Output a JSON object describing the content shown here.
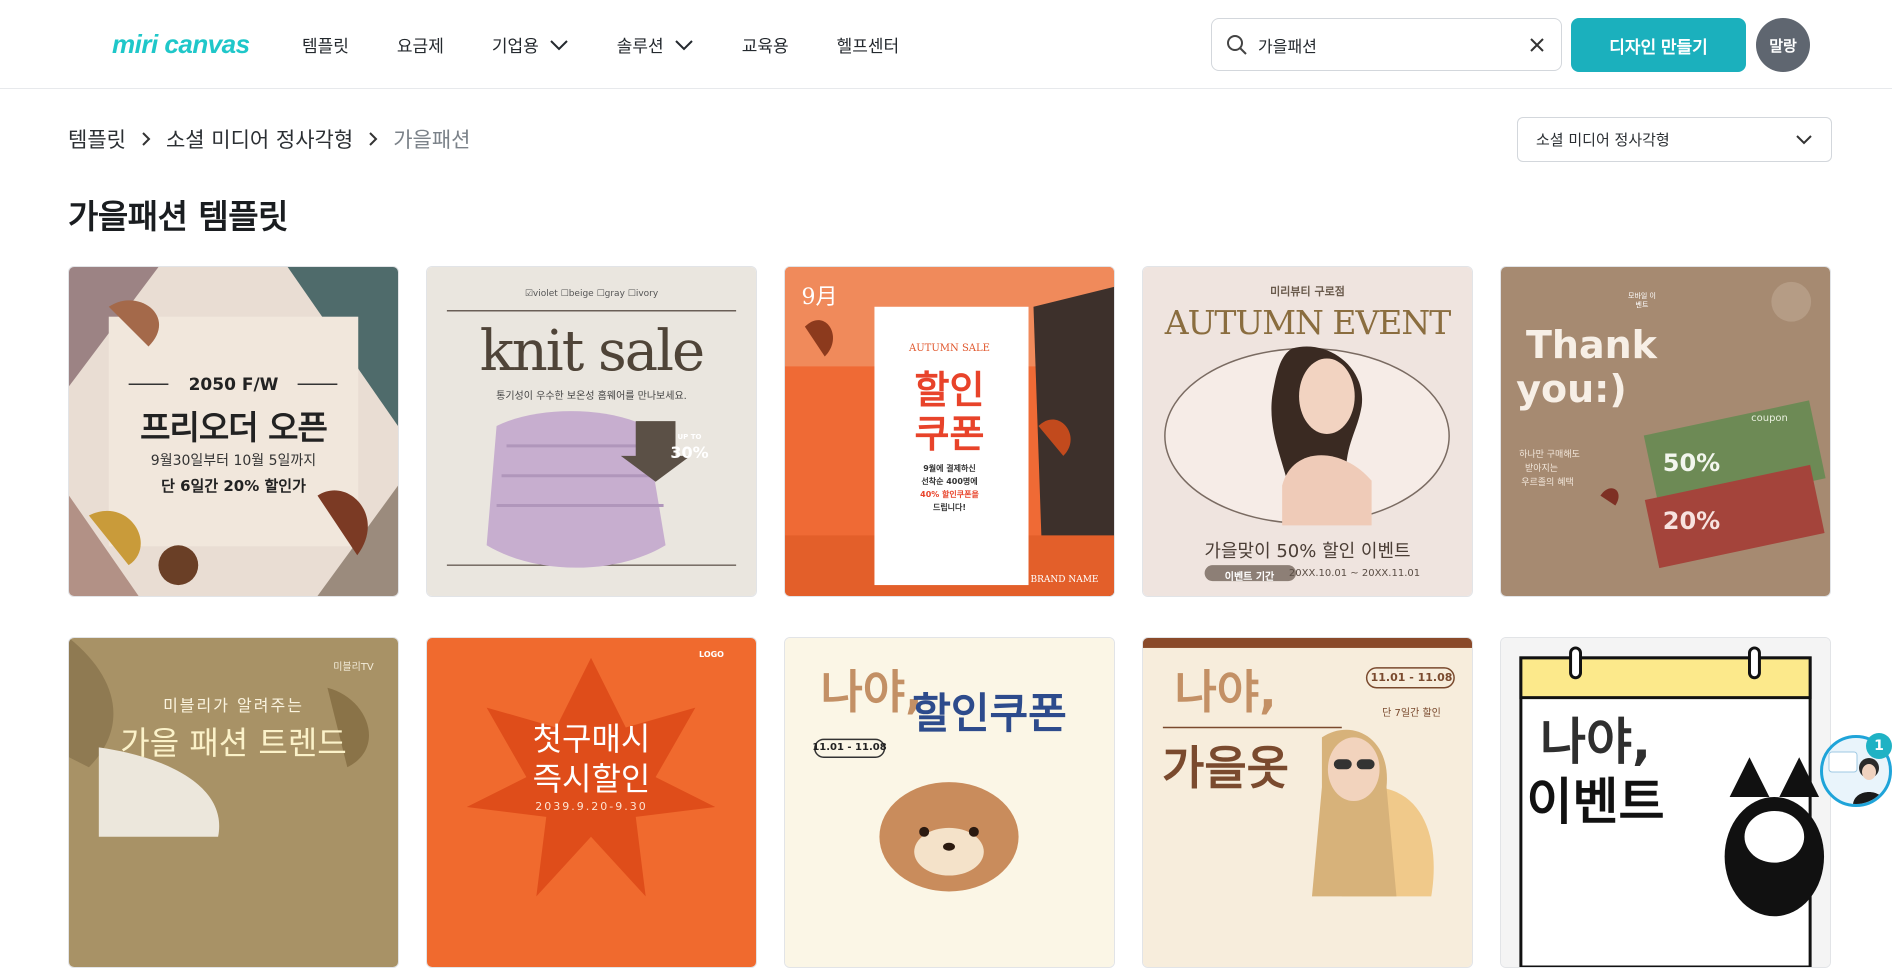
{
  "header": {
    "logo_text": "miri canvas",
    "nav": [
      {
        "label": "템플릿",
        "dropdown": false
      },
      {
        "label": "요금제",
        "dropdown": false
      },
      {
        "label": "기업용",
        "dropdown": true
      },
      {
        "label": "솔루션",
        "dropdown": true
      },
      {
        "label": "교육용",
        "dropdown": false
      },
      {
        "label": "헬프센터",
        "dropdown": false
      }
    ],
    "search_value": "가을패션",
    "make_button": "디자인 만들기",
    "avatar_label": "말랑"
  },
  "breadcrumb": [
    "템플릿",
    "소셜 미디어 정사각형",
    "가을패션"
  ],
  "format_select": "소셜 미디어 정사각형",
  "page_title": "가을패션 템플릿",
  "cards": {
    "c1": {
      "l1": "2050 F/W",
      "l2": "프리오더 오픈",
      "l3": "9월30일부터 10월 5일까지",
      "l4": "단 6일간 20% 할인가"
    },
    "c2": {
      "opts": "☑violet ☐beige ☐gray ☐ivory",
      "l1": "knit sale",
      "l2": "통기성이 우수한 보온성 홈웨어를 만나보세요.",
      "badge_up": "UP TO",
      "badge_pct": "30%"
    },
    "c3": {
      "month": "9月",
      "l1": "AUTUMN SALE",
      "l2": "할인",
      "l3": "쿠폰",
      "l4": "9월에 결제하신",
      "l5": "선착순 400명에",
      "l6": "40% 할인쿠폰을",
      "l7": "드립니다!",
      "brand": "BRAND NAME"
    },
    "c4": {
      "l0": "미리뷰티 구로점",
      "l1": "AUTUMN EVENT",
      "l2": "가을맞이 50% 할인 이벤트",
      "pill": "이벤트 기간",
      "dates": "20XX.10.01 ~ 20XX.11.01"
    },
    "c5": {
      "l1": "Thank",
      "l2": "you:)",
      "l3": "하나만 구매해도",
      "l4": "받아지는",
      "l5": "우르졸의 혜택",
      "coupon": "coupon",
      "p1": "50%",
      "p2": "20%",
      "stamp": "모바일 이벤트"
    },
    "c6": {
      "corner": "미블리TV",
      "l1": "미블리가 알려주는",
      "l2": "가을 패션 트렌드"
    },
    "c7": {
      "logo": "LOGO",
      "l1": "첫구매시",
      "l2": "즉시할인",
      "date": "2039.9.20-9.30"
    },
    "c8": {
      "l1": "나야,",
      "l2": "할인쿠폰",
      "date": "11.01 - 11.08"
    },
    "c9": {
      "l1": "나야,",
      "l2": "가을옷",
      "date": "11.01 - 11.08",
      "note": "단 7일간 할인"
    },
    "c10": {
      "l1": "나야,",
      "l2": "이벤트"
    }
  },
  "chat_badge": "1",
  "colors": {
    "accent": "#1bb0bd",
    "logo": "#1fc7c9",
    "avatar": "#5f6670"
  }
}
